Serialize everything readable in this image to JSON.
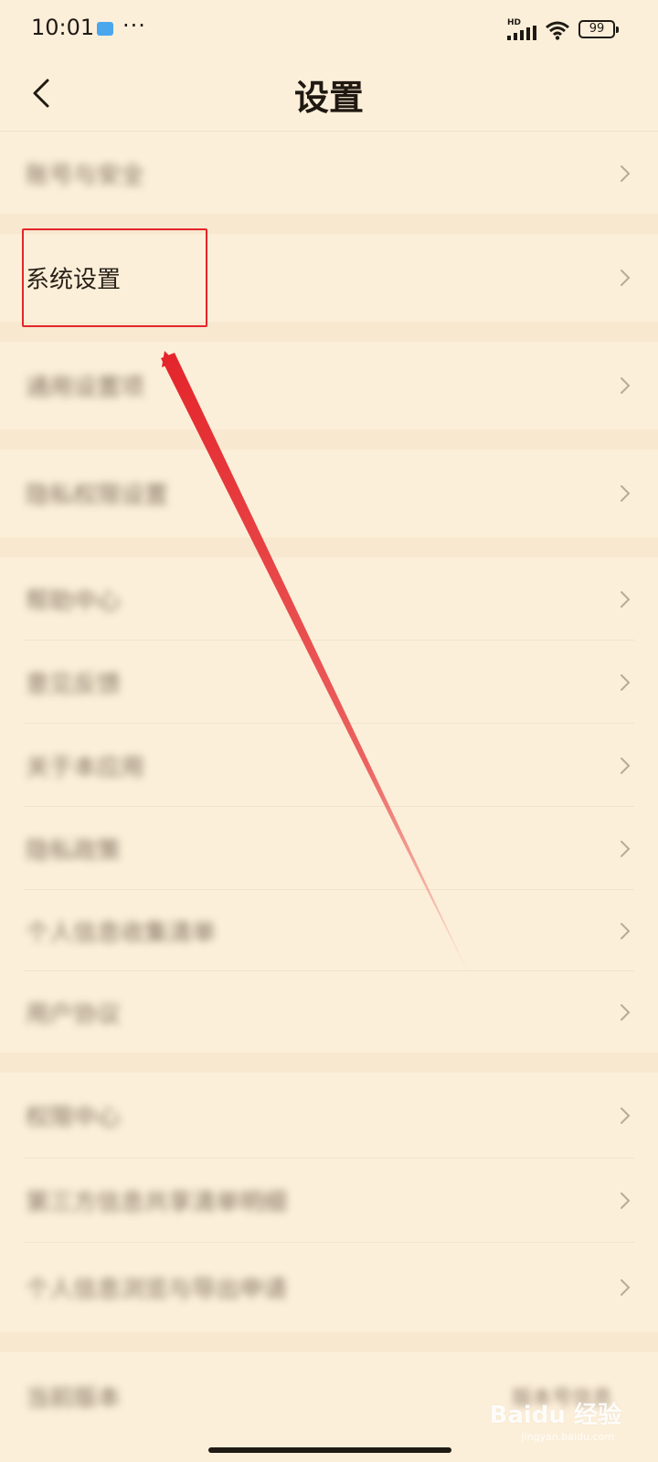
{
  "status_bar": {
    "time": "10:01",
    "more": "···",
    "network": "HD",
    "battery": "99"
  },
  "header": {
    "title": "设置"
  },
  "groups": [
    {
      "items": [
        {
          "label": "账号与安全",
          "blurred": true
        }
      ]
    },
    {
      "items": [
        {
          "label": "系统设置",
          "blurred": false,
          "highlighted": true
        }
      ]
    },
    {
      "items": [
        {
          "label": "通用设置项",
          "blurred": true
        }
      ]
    },
    {
      "items": [
        {
          "label": "隐私权限设置",
          "blurred": true
        }
      ]
    },
    {
      "items": [
        {
          "label": "帮助中心",
          "blurred": true
        },
        {
          "label": "意见反馈",
          "blurred": true
        },
        {
          "label": "关于本应用",
          "blurred": true
        },
        {
          "label": "隐私政策",
          "blurred": true
        },
        {
          "label": "个人信息收集清单",
          "blurred": true
        },
        {
          "label": "用户协议",
          "blurred": true
        }
      ]
    },
    {
      "items": [
        {
          "label": "权限中心",
          "blurred": true
        },
        {
          "label": "第三方信息共享清单明细",
          "blurred": true
        },
        {
          "label": "个人信息浏览与导出申请",
          "blurred": true
        }
      ]
    },
    {
      "items": [
        {
          "label": "当前版本",
          "blurred": true,
          "value": "版本号信息"
        }
      ]
    }
  ],
  "watermark": {
    "brand": "Baidu 经验",
    "sub": "jingyan.baidu.com"
  },
  "colors": {
    "background": "#fcefd9",
    "annotation": "#e4252b"
  }
}
